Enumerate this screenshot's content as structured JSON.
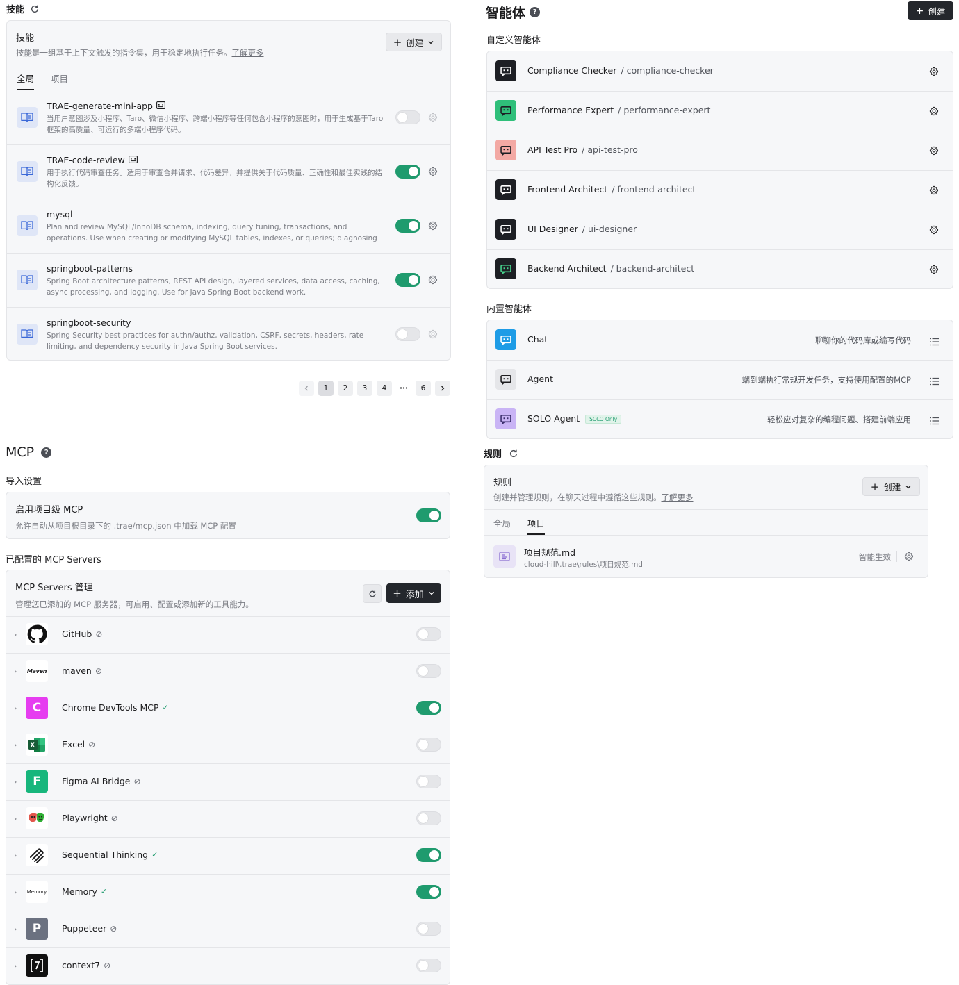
{
  "skills": {
    "section_title": "技能",
    "card_title": "技能",
    "card_desc": "技能是一组基于上下文触发的指令集，用于稳定地执行任务。",
    "learn_more": "了解更多",
    "create_label": "创建",
    "tabs": [
      {
        "label": "全局",
        "active": true
      },
      {
        "label": "项目",
        "active": false
      }
    ],
    "items": [
      {
        "name": "TRAE-generate-mini-app",
        "desc": "当用户意图涉及小程序、Taro、微信小程序、跨端小程序等任何包含小程序的意图时，用于生成基于Taro 框架的高质量、可运行的多端小程序代码。",
        "enabled": false,
        "has_badge": true
      },
      {
        "name": "TRAE-code-review",
        "desc": "用于执行代码审查任务。适用于审查合并请求、代码差异，并提供关于代码质量、正确性和最佳实践的结构化反馈。",
        "enabled": true,
        "has_badge": true
      },
      {
        "name": "mysql",
        "desc": "Plan and review MySQL/InnoDB schema, indexing, query tuning, transactions, and operations. Use when creating or modifying MySQL tables, indexes, or queries; diagnosing slow/locking behavior; pla...",
        "enabled": true,
        "has_badge": false
      },
      {
        "name": "springboot-patterns",
        "desc": "Spring Boot architecture patterns, REST API design, layered services, data access, caching, async processing, and logging. Use for Java Spring Boot backend work.",
        "enabled": true,
        "has_badge": false
      },
      {
        "name": "springboot-security",
        "desc": "Spring Security best practices for authn/authz, validation, CSRF, secrets, headers, rate limiting, and dependency security in Java Spring Boot services.",
        "enabled": false,
        "has_badge": false
      }
    ],
    "pagination": {
      "pages": [
        "1",
        "2",
        "3",
        "4",
        "6"
      ],
      "ellipsis": "···",
      "current": "1"
    }
  },
  "agents": {
    "section_title": "智能体",
    "help": "?",
    "create_label": "创建",
    "custom_title": "自定义智能体",
    "custom": [
      {
        "name": "Compliance Checker",
        "slug": "/ compliance-checker",
        "icon": "compliance-checker-icon"
      },
      {
        "name": "Performance Expert",
        "slug": "/ performance-expert",
        "icon": "performance-expert-icon"
      },
      {
        "name": "API Test Pro",
        "slug": "/ api-test-pro",
        "icon": "api-test-pro-icon"
      },
      {
        "name": "Frontend Architect",
        "slug": "/ frontend-architect",
        "icon": "frontend-architect-icon"
      },
      {
        "name": "UI Designer",
        "slug": "/ ui-designer",
        "icon": "ui-designer-icon"
      },
      {
        "name": "Backend Architect",
        "slug": "/ backend-architect",
        "icon": "backend-architect-icon"
      }
    ],
    "builtin_title": "内置智能体",
    "builtin": [
      {
        "name": "Chat",
        "desc": "聊聊你的代码库或编写代码",
        "badge": ""
      },
      {
        "name": "Agent",
        "desc": "端到端执行常规开发任务，支持使用配置的MCP",
        "badge": ""
      },
      {
        "name": "SOLO Agent",
        "desc": "轻松应对复杂的编程问题、搭建前端应用",
        "badge": "SOLO Only"
      }
    ]
  },
  "mcp": {
    "section_title": "MCP",
    "help": "?",
    "import_title": "导入设置",
    "project_mcp_title": "启用项目级 MCP",
    "project_mcp_desc": "允许自动从项目根目录下的 .trae/mcp.json 中加载 MCP 配置",
    "project_mcp_enabled": true,
    "configured_title": "已配置的 MCP Servers",
    "manage_title": "MCP Servers 管理",
    "manage_desc": "管理您已添加的 MCP 服务器，可启用、配置或添加新的工具能力。",
    "add_label": "添加",
    "servers": [
      {
        "name": "GitHub",
        "status": "disabled",
        "enabled": false,
        "logo": "github-icon",
        "letter": ""
      },
      {
        "name": "maven",
        "status": "disabled",
        "enabled": false,
        "logo": "maven-icon",
        "letter": "Maven"
      },
      {
        "name": "Chrome DevTools MCP",
        "status": "ok",
        "enabled": true,
        "logo": "chrome-devtools-icon",
        "letter": "C"
      },
      {
        "name": "Excel",
        "status": "disabled",
        "enabled": false,
        "logo": "excel-icon",
        "letter": "X"
      },
      {
        "name": "Figma AI Bridge",
        "status": "disabled",
        "enabled": false,
        "logo": "figma-icon",
        "letter": "F"
      },
      {
        "name": "Playwright",
        "status": "disabled",
        "enabled": false,
        "logo": "playwright-icon",
        "letter": ""
      },
      {
        "name": "Sequential Thinking",
        "status": "ok",
        "enabled": true,
        "logo": "sequential-thinking-icon",
        "letter": ""
      },
      {
        "name": "Memory",
        "status": "ok",
        "enabled": true,
        "logo": "memory-icon",
        "letter": "Memory"
      },
      {
        "name": "Puppeteer",
        "status": "disabled",
        "enabled": false,
        "logo": "puppeteer-icon",
        "letter": "P"
      },
      {
        "name": "context7",
        "status": "disabled",
        "enabled": false,
        "logo": "context7-icon",
        "letter": ""
      }
    ]
  },
  "rules": {
    "section_title": "规则",
    "card_title": "规则",
    "card_desc": "创建并管理规则，在聊天过程中遵循这些规则。",
    "learn_more": "了解更多",
    "create_label": "创建",
    "tabs": [
      {
        "label": "全局",
        "active": false
      },
      {
        "label": "项目",
        "active": true
      }
    ],
    "items": [
      {
        "name": "项目规范.md",
        "path": "cloud-hill\\.trae\\rules\\项目规范.md",
        "mode": "智能生效"
      }
    ]
  },
  "colors": {
    "accent_green": "#1f9b6e",
    "dark_button": "#24272c"
  }
}
